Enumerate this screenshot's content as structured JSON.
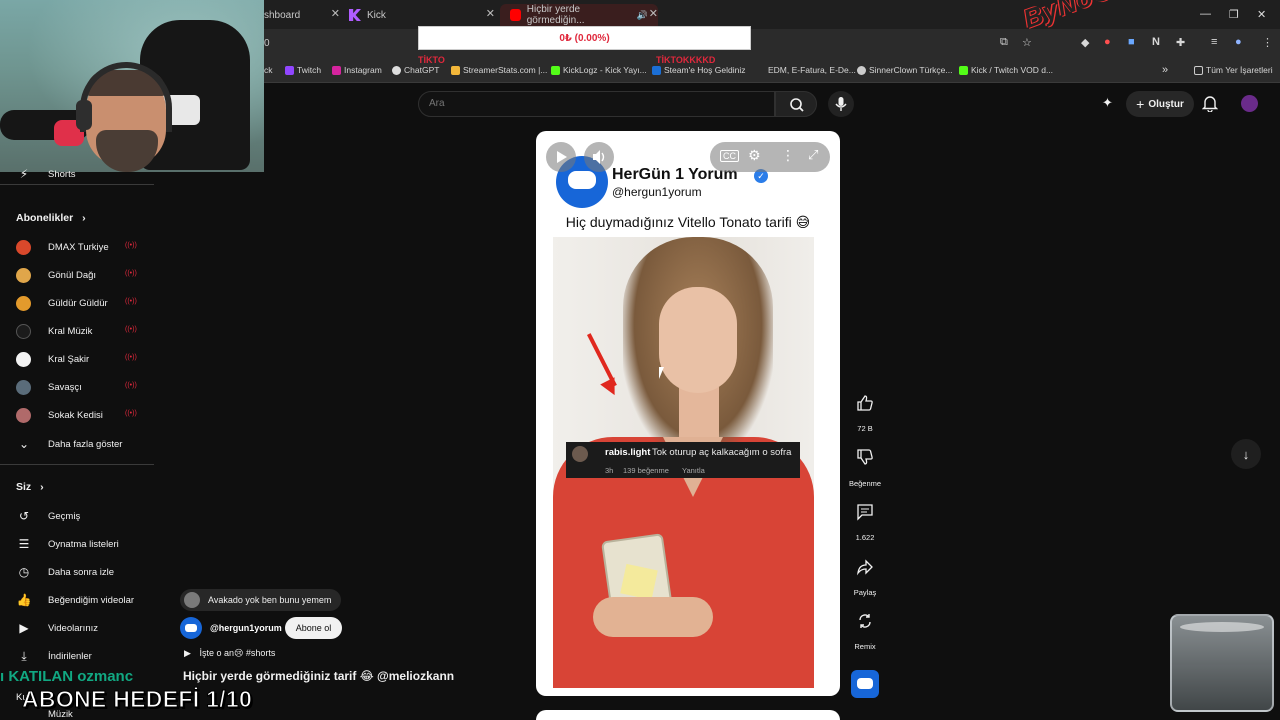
{
  "browser": {
    "tabs": [
      {
        "label": "shboard"
      },
      {
        "label": "Kick"
      },
      {
        "label": "Hiçbir yerde görmediğin..."
      }
    ],
    "address": "0",
    "bookmarks": [
      {
        "label": "ck"
      },
      {
        "label": "Twitch"
      },
      {
        "label": "Instagram"
      },
      {
        "label": "ChatGPT"
      },
      {
        "label": "StreamerStats.com |..."
      },
      {
        "label": "KickLogz - Kick Yayı..."
      },
      {
        "label": "Steam'e Hoş Geldiniz"
      },
      {
        "label": "EDM, E-Fatura, E-De..."
      },
      {
        "label": "SinnerClown Türkçe..."
      },
      {
        "label": "Kick / Twitch VOD d..."
      },
      {
        "label": "Tüm Yer İşaretleri"
      }
    ]
  },
  "overlay": {
    "donation": "0₺ (0.00%)",
    "brand": "ByNoGame",
    "red_labels": [
      "TİKTO",
      "TİKTOKKKKD"
    ],
    "ticker": "ı KATILAN ozmanc",
    "goal": "ABONE HEDEFİ 1/10"
  },
  "search": {
    "placeholder": "Ara"
  },
  "topbar": {
    "create_label": "Oluştur"
  },
  "sidebar": {
    "shorts_label": "Shorts",
    "subscriptions_heading": "Abonelikler",
    "subscriptions": [
      {
        "label": "DMAX Turkiye",
        "color": "#d9482b"
      },
      {
        "label": "Gönül Dağı",
        "color": "#e0a64a"
      },
      {
        "label": "Güldür Güldür",
        "color": "#e39a2c"
      },
      {
        "label": "Kral Müzik",
        "color": "#1b1b1b"
      },
      {
        "label": "Kral Şakir",
        "color": "#f2f2f2"
      },
      {
        "label": "Savaşçı",
        "color": "#5a6c7a"
      },
      {
        "label": "Sokak Kedisi",
        "color": "#b06a6a"
      }
    ],
    "show_more": "Daha fazla göster",
    "you_heading": "Siz",
    "you_items": [
      {
        "label": "Geçmiş",
        "icon": "history-icon"
      },
      {
        "label": "Oynatma listeleri",
        "icon": "playlist-icon"
      },
      {
        "label": "Daha sonra izle",
        "icon": "clock-icon"
      },
      {
        "label": "Beğendiğim videolar",
        "icon": "thumbs-up-icon"
      },
      {
        "label": "Videolarınız",
        "icon": "video-icon"
      },
      {
        "label": "İndirilenler",
        "icon": "download-icon"
      }
    ],
    "more_label": "Kurs",
    "music_label": "Müzik"
  },
  "short": {
    "channel_name": "HerGün 1 Yorum",
    "channel_handle": "@hergun1yorum",
    "caption": "Hiç duymadığınız Vitello Tonato tarifi 😅",
    "comment": {
      "user": "rabis.light",
      "text": "Tok oturup aç kalkacağım o sofra",
      "time": "3h",
      "likes": "139 beğenme",
      "reply": "Yanıtla"
    }
  },
  "actions": {
    "like_count": "72 B",
    "dislike_label": "Beğenme",
    "comment_count": "1.622",
    "share_label": "Paylaş",
    "remix_label": "Remix"
  },
  "below": {
    "suggestion": "Avakado yok ben bunu yemem",
    "handle": "@hergun1yorum",
    "subscribe_label": "Abone ol",
    "sound": "İşte o an😢 #shorts",
    "title": "Hiçbir yerde görmediğiniz tarif 😂 @meliozkann"
  }
}
